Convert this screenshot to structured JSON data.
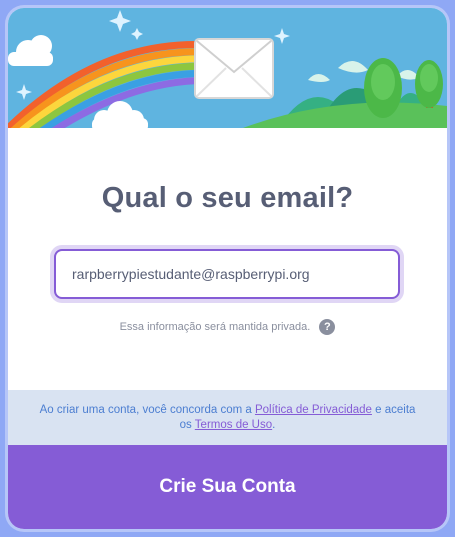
{
  "form": {
    "title": "Qual o seu email?",
    "email_value": "rarpberrypiestudante@raspberrypi.org",
    "email_placeholder": "",
    "privacy_note": "Essa informação será mantida privada.",
    "help_icon_glyph": "?"
  },
  "terms": {
    "prefix": "Ao criar uma conta, você concorda com a ",
    "privacy_link": "Política de Privacidade",
    "middle": " e aceita os ",
    "terms_link": "Termos de Uso",
    "suffix": "."
  },
  "footer": {
    "submit_label": "Crie Sua Conta"
  },
  "colors": {
    "accent": "#855cd6",
    "sky": "#5fb4e0",
    "page_background": "#8fa8f5",
    "title_text": "#575e75",
    "terms_background": "#d9e3f2",
    "terms_text": "#4c7ed1"
  },
  "banner": {
    "icons": [
      "envelope-icon",
      "rainbow",
      "cloud-icon",
      "sparkle-icon",
      "tree-icon",
      "mountain-icon"
    ]
  }
}
